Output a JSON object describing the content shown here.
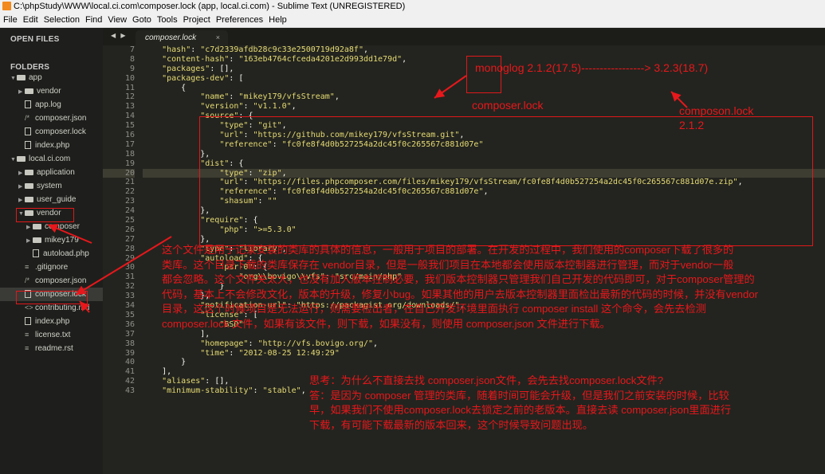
{
  "window": {
    "title": "C:\\phpStudy\\WWW\\local.ci.com\\composer.lock (app, local.ci.com) - Sublime Text (UNREGISTERED)"
  },
  "menu": [
    "File",
    "Edit",
    "Selection",
    "Find",
    "View",
    "Goto",
    "Tools",
    "Project",
    "Preferences",
    "Help"
  ],
  "sidebar": {
    "open_files_label": "OPEN FILES",
    "folders_label": "FOLDERS",
    "tree": [
      {
        "label": "app",
        "kind": "folder-open",
        "indent": 0
      },
      {
        "label": "vendor",
        "kind": "folder",
        "indent": 1
      },
      {
        "label": "app.log",
        "kind": "file",
        "indent": 1
      },
      {
        "label": "composer.json",
        "kind": "json",
        "indent": 1
      },
      {
        "label": "composer.lock",
        "kind": "file",
        "indent": 1
      },
      {
        "label": "index.php",
        "kind": "file",
        "indent": 1
      },
      {
        "label": "local.ci.com",
        "kind": "folder-open",
        "indent": 0
      },
      {
        "label": "application",
        "kind": "folder",
        "indent": 1
      },
      {
        "label": "system",
        "kind": "folder",
        "indent": 1
      },
      {
        "label": "user_guide",
        "kind": "folder",
        "indent": 1
      },
      {
        "label": "vendor",
        "kind": "folder-open",
        "indent": 1
      },
      {
        "label": "composer",
        "kind": "folder",
        "indent": 2
      },
      {
        "label": "mikey179",
        "kind": "folder",
        "indent": 2
      },
      {
        "label": "autoload.php",
        "kind": "file",
        "indent": 2
      },
      {
        "label": ".gitignore",
        "kind": "lines",
        "indent": 1
      },
      {
        "label": "composer.json",
        "kind": "json",
        "indent": 1
      },
      {
        "label": "composer.lock",
        "kind": "file",
        "indent": 1,
        "selected": true
      },
      {
        "label": "contributing.md",
        "kind": "md",
        "indent": 1
      },
      {
        "label": "index.php",
        "kind": "file",
        "indent": 1
      },
      {
        "label": "license.txt",
        "kind": "lines",
        "indent": 1
      },
      {
        "label": "readme.rst",
        "kind": "lines",
        "indent": 1
      }
    ]
  },
  "tab": {
    "label": "composer.lock",
    "close": "×",
    "nav": "◀ ▶"
  },
  "editor": {
    "line_numbers": [
      "7",
      "8",
      "9",
      "10",
      "11",
      "12",
      "13",
      "14",
      "15",
      "16",
      "17",
      "18",
      "19",
      "20",
      "21",
      "22",
      "23",
      "24",
      "25",
      "26",
      "27",
      "28",
      "29",
      "30",
      "31",
      "32",
      "33",
      "34",
      "35",
      "36",
      "37",
      "38",
      "39",
      "40",
      "41",
      "42",
      "43"
    ],
    "lines": [
      "    \"hash\": \"c7d2339afdb28c9c33e2500719d92a8f\",",
      "    \"content-hash\": \"163eb4764cfceda4201e2d993dd1e79d\",",
      "    \"packages\": [],",
      "    \"packages-dev\": [",
      "        {",
      "            \"name\": \"mikey179/vfsStream\",",
      "            \"version\": \"v1.1.0\",",
      "            \"source\": {",
      "                \"type\": \"git\",",
      "                \"url\": \"https://github.com/mikey179/vfsStream.git\",",
      "                \"reference\": \"fc0fe8f4d0b527254a2dc45f0c265567c881d07e\"",
      "            },",
      "            \"dist\": {",
      "                \"type\": \"zip\",",
      "                \"url\": \"https://files.phpcomposer.com/files/mikey179/vfsStream/fc0fe8f4d0b527254a2dc45f0c265567c881d07e.zip\",",
      "                \"reference\": \"fc0fe8f4d0b527254a2dc45f0c265567c881d07e\",",
      "                \"shasum\": \"\"",
      "            },",
      "            \"require\": {",
      "                \"php\": \">=5.3.0\"",
      "            },",
      "            \"type\": \"library\",",
      "            \"autoload\": {",
      "                \"psr-0\": {",
      "                    \"org\\\\bovigo\\\\vfs\": \"src/main/php\"",
      "                }",
      "            },",
      "            \"notification-url\": \"https://packagist.org/downloads/\",",
      "            \"license\": [",
      "                \"BSD\"",
      "            ],",
      "            \"homepage\": \"http://vfs.bovigo.org/\",",
      "            \"time\": \"2012-08-25 12:49:29\"",
      "        }",
      "    ],",
      "    \"aliases\": [],",
      "    \"minimum-stability\": \"stable\","
    ]
  },
  "annotations": {
    "monolog": "monoglog 2.1.2(17.5)-----------------> 3.2.3(18.7)",
    "composer_lock": "composer.lock",
    "composon_lock": "composon.lock",
    "version_212": "2.1.2",
    "paragraph": [
      "这个文件是用于记录安装的类库的具体的信息，一般用于项目的部署。在开发的过程中，我们使用的composer下载了很多的",
      "类库。这个目录下载的类库保存在 vendor目录，但是一般我们项目在本地都会使用版本控制器进行管理，而对于vendor一般",
      "都会忽略。这个文件夹太大，也没有加入版本控制必要，我们版本控制器只管理我们自己开发的代码即可，对于composer管理的",
      "代码，基本上不会修改文化，版本的升级，修复小bug。如果其他的用户去版本控制器里面检出最新的代码的时候，并没有vendor",
      "目录，这这个时候项目是无法运行，则需要检出者，在自己开发环境里面执行 composer install 这个命令，会先去检测",
      "composer.lock 文件，如果有该文件，则下载，如果没有，则使用 composer.json 文件进行下载。"
    ],
    "think": [
      "思考：为什么不直接去找 composer.json文件，会先去找composer.lock文件?",
      "答：是因为 composer 管理的类库，随着时间可能会升级，但是我们之前安装的时候，比较",
      "早，如果我们不使用composer.lock去锁定之前的老版本。直接去读 composer.json里面进行",
      "下载，有可能下载最新的版本回来，这个时候导致问题出现。"
    ]
  },
  "colors": {
    "editor_bg": "#23241f",
    "sidebar_bg": "#1e1f1c",
    "annotation_red": "#e8171b",
    "string": "#e6db74",
    "code_text": "#f8f8f2",
    "line_number": "#90908a"
  }
}
